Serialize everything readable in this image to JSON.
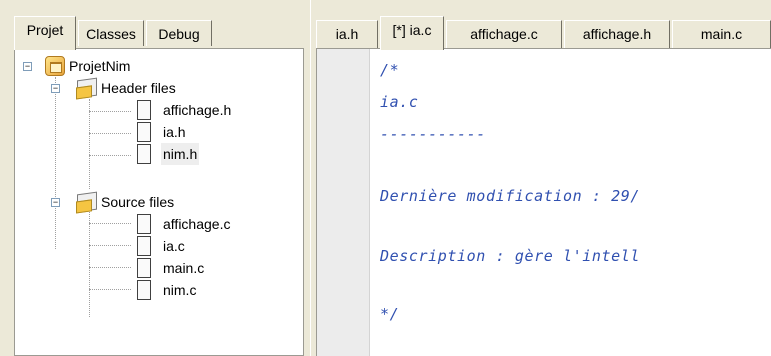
{
  "project_panel": {
    "tabs": [
      {
        "label": "Projet",
        "active": true
      },
      {
        "label": "Classes",
        "active": false
      },
      {
        "label": "Debug",
        "active": false
      }
    ],
    "tree": {
      "project": {
        "label": "ProjetNim",
        "icon": "project-icon",
        "expander": "−"
      },
      "header_folder": {
        "label": "Header files",
        "icon": "folder-icon",
        "expander": "−"
      },
      "header_files": [
        {
          "label": "affichage.h",
          "icon": "file-icon"
        },
        {
          "label": "ia.h",
          "icon": "file-icon"
        },
        {
          "label": "nim.h",
          "icon": "file-icon",
          "selected": true
        }
      ],
      "source_folder": {
        "label": "Source files",
        "icon": "folder-icon",
        "expander": "−"
      },
      "source_files": [
        {
          "label": "affichage.c",
          "icon": "file-icon"
        },
        {
          "label": "ia.c",
          "icon": "file-icon"
        },
        {
          "label": "main.c",
          "icon": "file-icon"
        },
        {
          "label": "nim.c",
          "icon": "file-icon"
        }
      ]
    }
  },
  "editor": {
    "tabs": [
      {
        "label": "ia.h",
        "active": false
      },
      {
        "label": "[*] ia.c",
        "active": true
      },
      {
        "label": "affichage.c",
        "active": false
      },
      {
        "label": "affichage.h",
        "active": false
      },
      {
        "label": "main.c",
        "active": false
      }
    ],
    "code_lines": [
      "/*",
      "ia.c",
      "-----------",
      "",
      "Dernière modification : 29/",
      "",
      "Description : gère l'intell",
      "",
      "*/"
    ],
    "comment_color": "#3050b0"
  }
}
